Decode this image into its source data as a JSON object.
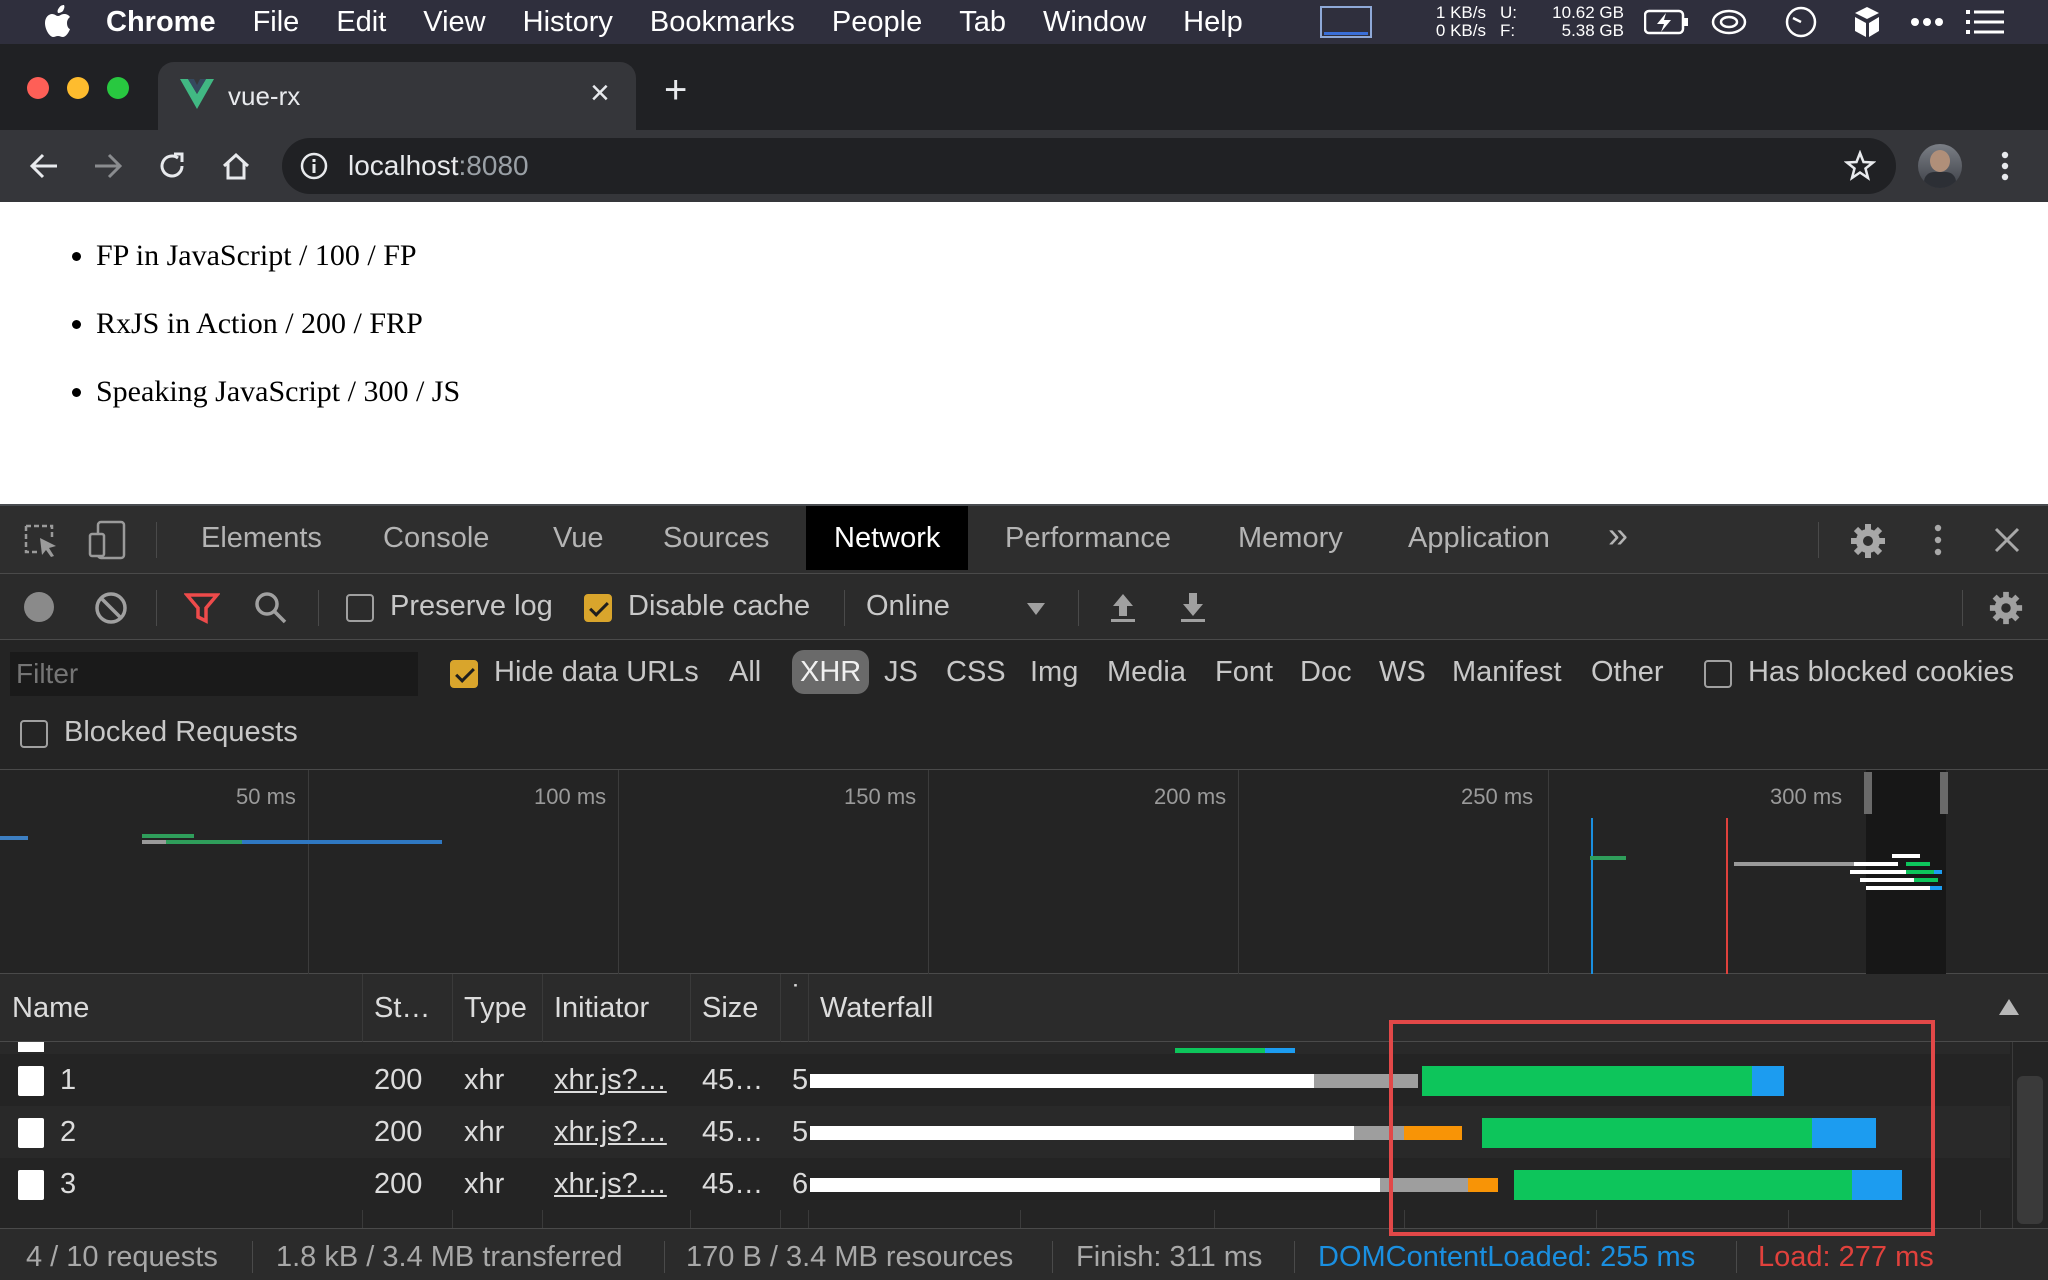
{
  "menubar": {
    "items": [
      "Chrome",
      "File",
      "Edit",
      "View",
      "History",
      "Bookmarks",
      "People",
      "Tab",
      "Window",
      "Help"
    ],
    "net_up": "1 KB/s",
    "net_down": "0 KB/s",
    "mem_u_label": "U:",
    "mem_f_label": "F:",
    "mem_u": "10.62 GB",
    "mem_f": "5.38 GB",
    "icons": [
      "apple-icon",
      "screen-monitor-icon",
      "battery-charging-icon",
      "creative-cloud-icon",
      "clock-icon",
      "dropbox-icon",
      "more-dots-icon",
      "list-icon"
    ]
  },
  "browser": {
    "tab_title": "vue-rx",
    "url_host": "localhost",
    "url_port": ":8080",
    "tab_close": "×",
    "new_tab": "+"
  },
  "page": {
    "items": [
      "FP in JavaScript / 100 / FP",
      "RxJS in Action / 200 / FRP",
      "Speaking JavaScript / 300 / JS"
    ]
  },
  "devtools": {
    "tabs": [
      "Elements",
      "Console",
      "Vue",
      "Sources",
      "Network",
      "Performance",
      "Memory",
      "Application"
    ],
    "active_tab": "Network",
    "more_tabs": "»",
    "toolbar": {
      "preserve_log": "Preserve log",
      "disable_cache": "Disable cache",
      "throttle": "Online"
    },
    "filter": {
      "placeholder": "Filter",
      "hide_data_urls": "Hide data URLs",
      "types": [
        "All",
        "XHR",
        "JS",
        "CSS",
        "Img",
        "Media",
        "Font",
        "Doc",
        "WS",
        "Manifest",
        "Other"
      ],
      "active_type": "XHR",
      "has_blocked_cookies": "Has blocked cookies",
      "blocked_requests": "Blocked Requests"
    },
    "overview_ticks": [
      "50 ms",
      "100 ms",
      "150 ms",
      "200 ms",
      "250 ms",
      "300 ms"
    ],
    "table": {
      "headers": {
        "name": "Name",
        "status": "St…",
        "type": "Type",
        "initiator": "Initiator",
        "size": "Size",
        "time": "˙",
        "waterfall": "Waterfall"
      },
      "rows": [
        {
          "name": "1",
          "status": "200",
          "type": "xhr",
          "initiator": "xhr.js?…",
          "size": "45…",
          "time": "5"
        },
        {
          "name": "2",
          "status": "200",
          "type": "xhr",
          "initiator": "xhr.js?…",
          "size": "45…",
          "time": "5"
        },
        {
          "name": "3",
          "status": "200",
          "type": "xhr",
          "initiator": "xhr.js?…",
          "size": "45…",
          "time": "6"
        }
      ]
    },
    "status_bar": {
      "requests": "4 / 10 requests",
      "transferred": "1.8 kB / 3.4 MB transferred",
      "resources": "170 B / 3.4 MB resources",
      "finish": "Finish: 311 ms",
      "dom_content_loaded": "DOMContentLoaded: 255 ms",
      "load": "Load: 277 ms"
    },
    "colors": {
      "green": "#0dc55b",
      "blue": "#1c9cf0",
      "orange": "#f89406",
      "highlight": "#e24848",
      "dcl": "#1a8fe0",
      "load": "#e0413c"
    }
  }
}
